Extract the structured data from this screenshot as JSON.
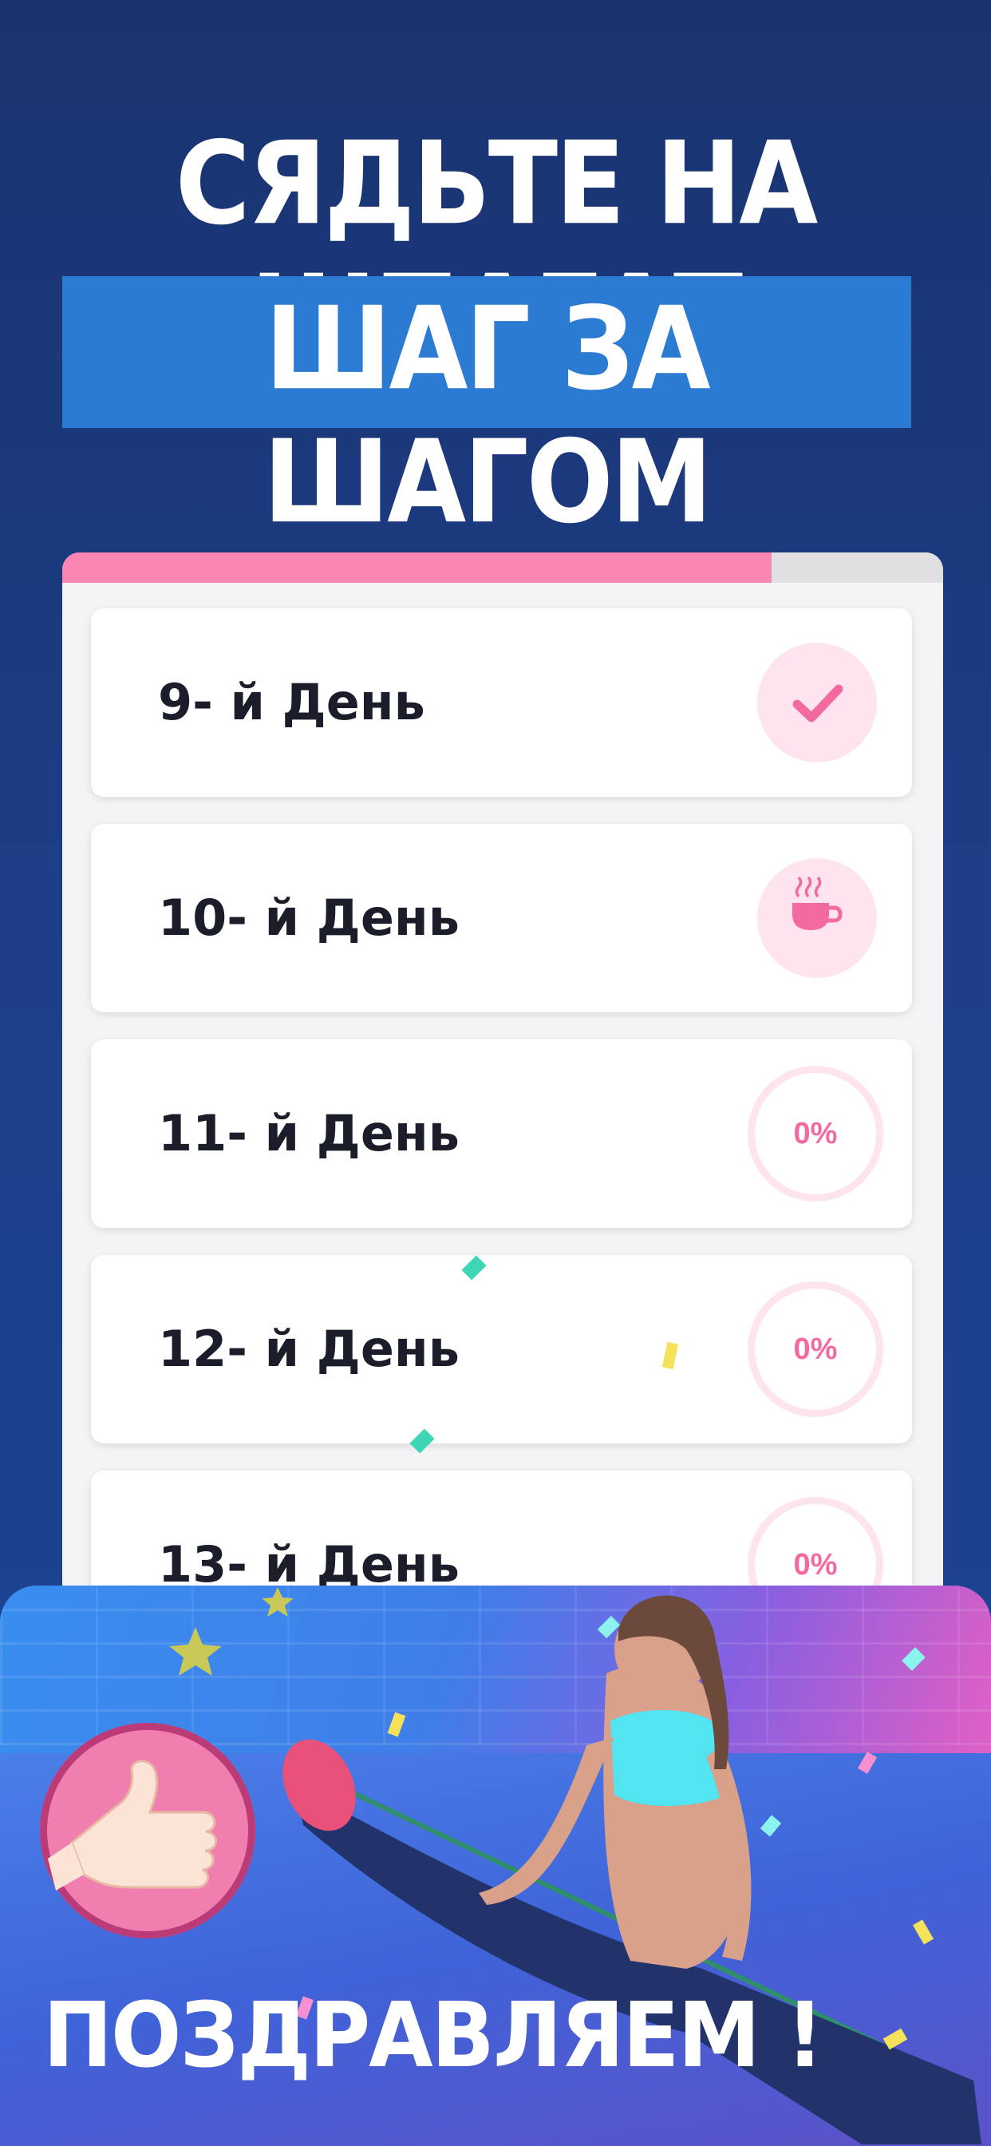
{
  "header": {
    "title": "СЯДЬТЕ НА ШПАГАТ",
    "subtitle": "ШАГ ЗА ШАГОМ"
  },
  "progress": {
    "fraction": 0.805,
    "color": "#fb86b4"
  },
  "days": [
    {
      "label": "9- й День",
      "status": "completed",
      "icon": "check-icon"
    },
    {
      "label": "10- й День",
      "status": "rest",
      "icon": "coffee-cup-icon"
    },
    {
      "label": "11- й День",
      "status": "progress",
      "percent": "0%"
    },
    {
      "label": "12- й День",
      "status": "progress",
      "percent": "0%"
    },
    {
      "label": "13- й День",
      "status": "progress",
      "percent": "0%"
    }
  ],
  "banner": {
    "message": "ПОЗДРАВЛЯЕМ !",
    "icon": "thumbs-up-icon"
  },
  "colors": {
    "background": "#1c3f88",
    "highlight": "#2a7bd1",
    "accent_pink": "#f36aa1",
    "badge_bg": "#fde4ee"
  }
}
